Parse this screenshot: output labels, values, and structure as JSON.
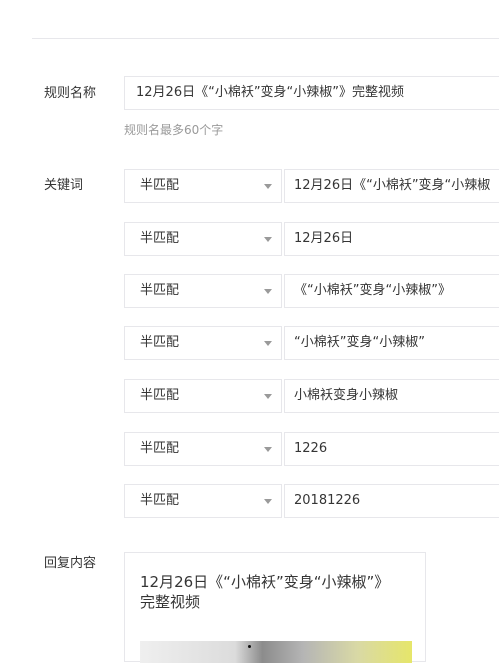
{
  "rule_name": {
    "label": "规则名称",
    "value": "12月26日《“小棉袄”变身“小辣椒”》完整视频",
    "hint": "规则名最多60个字"
  },
  "keywords": {
    "label": "关键词",
    "rows": [
      {
        "match": "半匹配",
        "value": "12月26日《“小棉袄”变身“小辣椒"
      },
      {
        "match": "半匹配",
        "value": "12月26日"
      },
      {
        "match": "半匹配",
        "value": "《“小棉袄”变身“小辣椒”》"
      },
      {
        "match": "半匹配",
        "value": "“小棉袄”变身“小辣椒”"
      },
      {
        "match": "半匹配",
        "value": "小棉袄变身小辣椒"
      },
      {
        "match": "半匹配",
        "value": "1226"
      },
      {
        "match": "半匹配",
        "value": "20181226"
      }
    ]
  },
  "reply": {
    "label": "回复内容",
    "title": "12月26日《“小棉袄”变身“小辣椒”》完整视频"
  },
  "icons": {
    "dropdown": "chevron-down-icon"
  },
  "colors": {
    "border": "#e7e7eb",
    "text": "#353535",
    "hint": "#9a9a9a"
  }
}
